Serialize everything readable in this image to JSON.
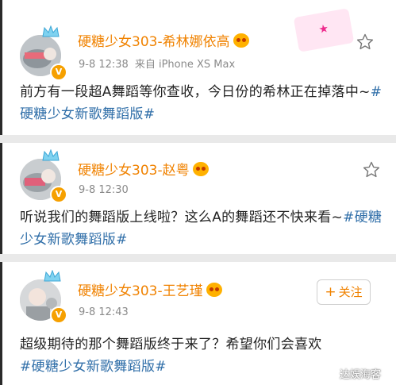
{
  "posts": [
    {
      "author": "硬糖少女303-希林娜依高",
      "date": "9-8 12:38",
      "source": "来自 iPhone XS Max",
      "text": "前方有一段超A舞蹈等你查收，今日份的希林正在掉落中~",
      "hashtag": "#硬糖少女新歌舞蹈版#",
      "action": "star-icon"
    },
    {
      "author": "硬糖少女303-赵粤",
      "date": "9-8 12:30",
      "text": "听说我们的舞蹈版上线啦？这么A的舞蹈还不快来看~",
      "hashtag": "#硬糖少女新歌舞蹈版#",
      "action": "star-icon"
    },
    {
      "author": "硬糖少女303-王艺瑾",
      "date": "9-8 12:43",
      "text": "超级期待的那个舞蹈版终于来了？希望你们会喜欢",
      "hashtag": "#硬糖少女新歌舞蹈版#",
      "action_label": "关注",
      "action_symbol": "+"
    }
  ],
  "verified_badge": "V",
  "watermark": "达娱海客",
  "colors": {
    "name": "#f08200",
    "hashtag": "#2f6ea8",
    "meta": "#8a8a8a",
    "separator": "#e9e9e9"
  }
}
